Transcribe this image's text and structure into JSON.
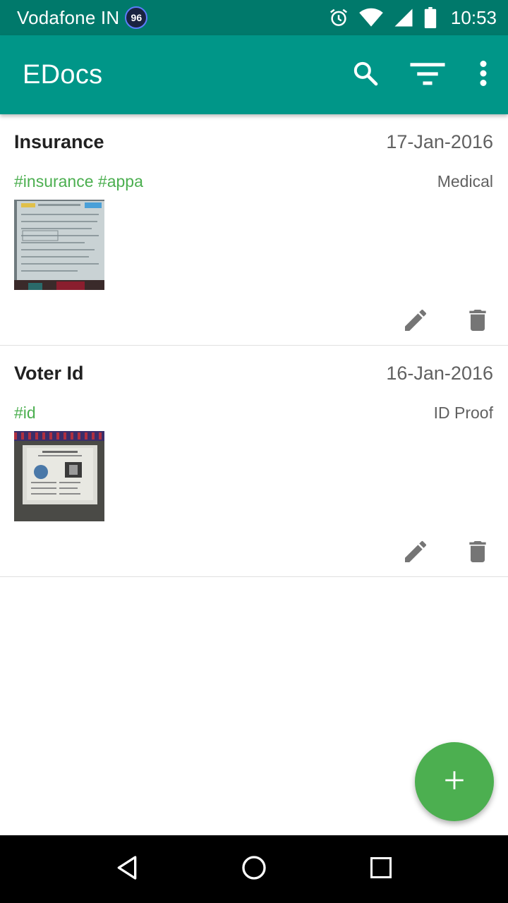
{
  "status_bar": {
    "carrier": "Vodafone IN",
    "badge": "96",
    "time": "10:53",
    "icons": [
      "alarm-icon",
      "wifi-icon",
      "signal-icon",
      "battery-icon"
    ]
  },
  "app_bar": {
    "title": "EDocs",
    "actions": [
      "search-icon",
      "filter-icon",
      "more-vert-icon"
    ],
    "color": "#009688"
  },
  "documents": [
    {
      "title": "Insurance",
      "date": "17-Jan-2016",
      "tags": "#insurance #appa",
      "category": "Medical",
      "thumbnail": "insurance-form-photo"
    },
    {
      "title": "Voter Id",
      "date": "16-Jan-2016",
      "tags": "#id",
      "category": "ID Proof",
      "thumbnail": "voter-id-card-photo"
    }
  ],
  "fab": {
    "icon": "plus-icon",
    "color": "#4caf50"
  },
  "nav_bar": {
    "icons": [
      "back-icon",
      "home-icon",
      "recents-icon"
    ]
  },
  "colors": {
    "accent": "#4caf50",
    "primary": "#009688",
    "primary_dark": "#00796b"
  }
}
